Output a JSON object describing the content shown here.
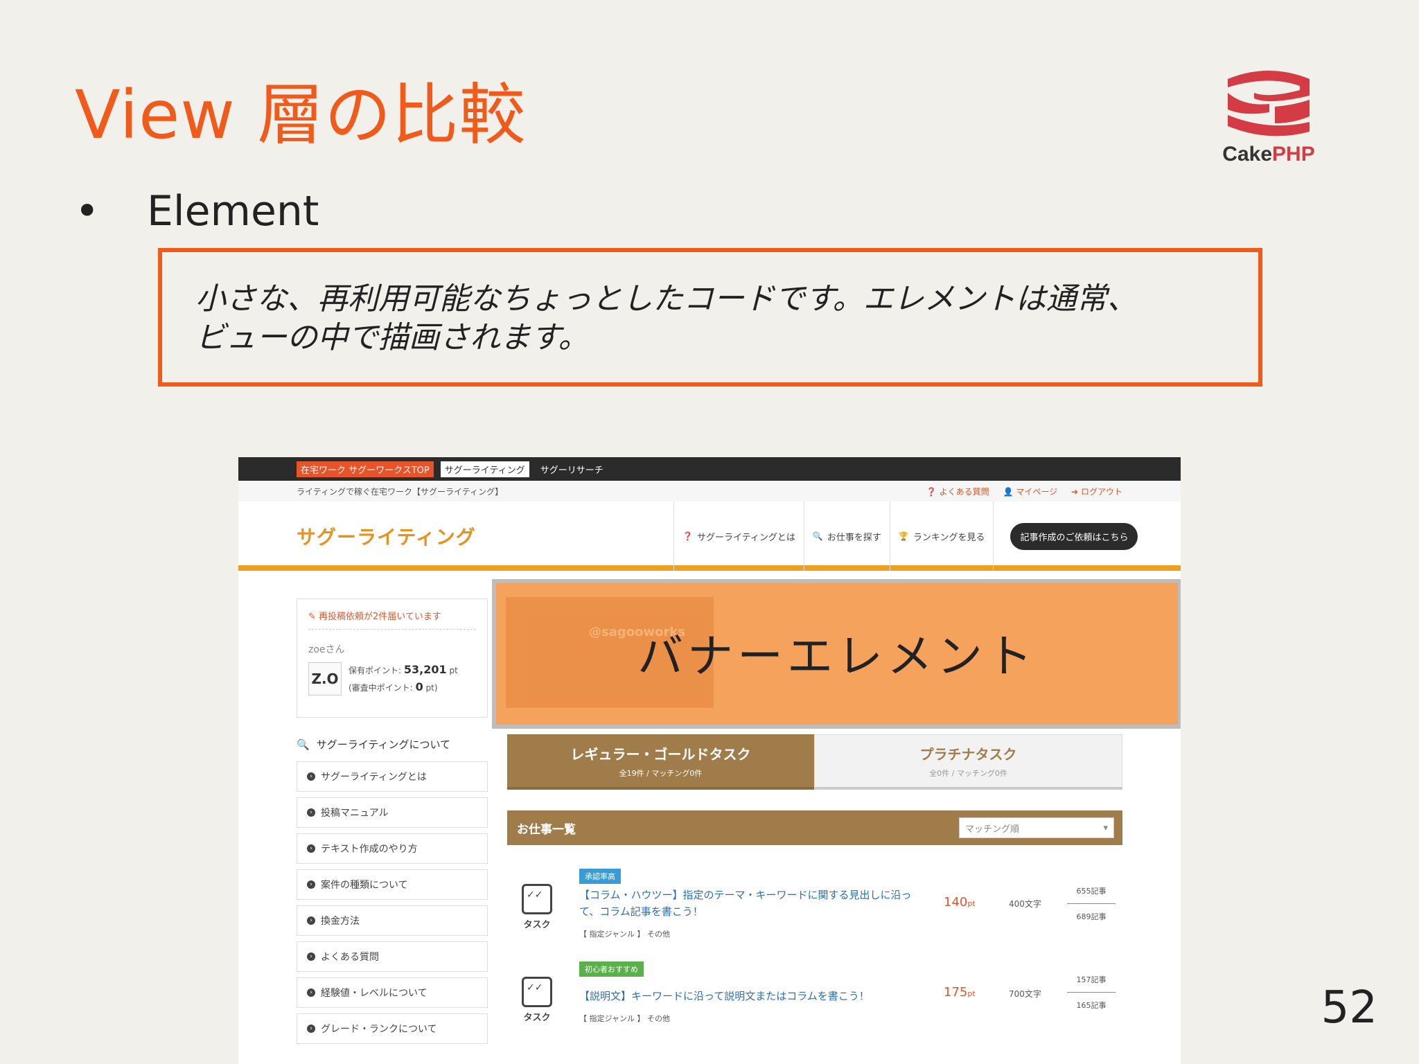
{
  "slide": {
    "title": "View 層の比較",
    "bullet_marker": "•",
    "bullet": "Element",
    "quote_line1": "小さな、再利用可能なちょっとしたコードです。エレメントは通常、",
    "quote_line2": "ビューの中で描画されます。",
    "page_number": "52",
    "logo_text_1": "Cake",
    "logo_text_2": "PHP",
    "accent_color": "#f05a1a"
  },
  "site": {
    "topbar": [
      "在宅ワーク サグーワークスTOP",
      "サグーライティング",
      "サグーリサーチ"
    ],
    "tagline": "ライティングで稼ぐ在宅ワーク【サグーライティング】",
    "top_links": [
      "よくある質問",
      "マイページ",
      "ログアウト"
    ],
    "logo": "サグーライティング",
    "nav": [
      "サグーライティングとは",
      "お仕事を探す",
      "ランキングを見る"
    ],
    "nav_cta": "記事作成のご依頼はこちら",
    "user": {
      "notice": "再投稿依頼が2件届いています",
      "name": "zoeさん",
      "avatar": "Z.O",
      "points_label": "保有ポイント:",
      "points_value": "53,201",
      "points_unit": "pt",
      "pending_label": "(審査中ポイント:",
      "pending_value": "0",
      "pending_unit": "pt)"
    },
    "sidebar_heading": "サグーライティングについて",
    "sidebar_items": [
      "サグーライティングとは",
      "投稿マニュアル",
      "テキスト作成のやり方",
      "案件の種類について",
      "換金方法",
      "よくある質問",
      "経験値・レベルについて",
      "グレード・ランクについて"
    ],
    "banner_label": "バナーエレメント",
    "banner_ghost": "@sagooworks",
    "tabs": [
      {
        "label": "レギュラー・ゴールドタスク",
        "sub": "全19件 / マッチング0件"
      },
      {
        "label": "プラチナタスク",
        "sub": "全0件 / マッチング0件"
      }
    ],
    "jobs_heading": "お仕事一覧",
    "sort_value": "マッチング順",
    "jobs": [
      {
        "badge": "承認率高",
        "badge_color": "#3a9bd5",
        "icon_label": "タスク",
        "title": "【コラム・ハウツー】指定のテーマ・キーワードに関する見出しに沿って、コラム記事を書こう！",
        "genre": "【 指定ジャンル 】 その他",
        "points": "140",
        "pt_unit": "pt",
        "chars": "400文字",
        "count_top": "655記事",
        "count_bottom": "689記事"
      },
      {
        "badge": "初心者おすすめ",
        "badge_color": "#5ab04a",
        "icon_label": "タスク",
        "title": "【説明文】キーワードに沿って説明文またはコラムを書こう！",
        "genre": "【 指定ジャンル 】 その他",
        "points": "175",
        "pt_unit": "pt",
        "chars": "700文字",
        "count_top": "157記事",
        "count_bottom": "165記事"
      }
    ]
  }
}
